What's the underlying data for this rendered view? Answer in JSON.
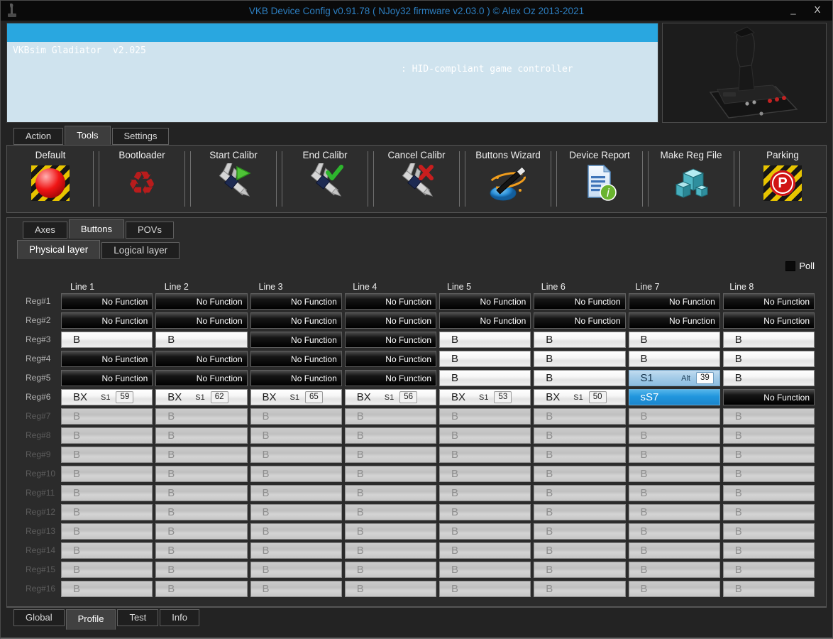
{
  "title_bar": {
    "title": "VKB Device Config v0.91.78 ( NJoy32 firmware v2.03.0 ) © Alex Oz 2013-2021",
    "minimize_label": "_",
    "close_label": "X"
  },
  "device_list": {
    "selected": {
      "name": "VKBsim Gladiator  v2.025",
      "type": ": HID-compliant game controller"
    }
  },
  "main_tabs": [
    {
      "label": "Action",
      "active": false
    },
    {
      "label": "Tools",
      "active": true
    },
    {
      "label": "Settings",
      "active": false
    }
  ],
  "toolbar": {
    "buttons": [
      {
        "label": "Default",
        "icon": "hazard-ball-icon"
      },
      {
        "label": "Bootloader",
        "icon": "recycle-icon"
      },
      {
        "label": "Start Calibr",
        "icon": "caliper-play-icon"
      },
      {
        "label": "End Calibr",
        "icon": "caliper-check-icon"
      },
      {
        "label": "Cancel Calibr",
        "icon": "caliper-cross-icon"
      },
      {
        "label": "Buttons Wizard",
        "icon": "wizard-wand-icon"
      },
      {
        "label": "Device Report",
        "icon": "document-info-icon"
      },
      {
        "label": "Make Reg File",
        "icon": "registry-cubes-icon"
      },
      {
        "label": "Parking",
        "icon": "parking-icon"
      }
    ]
  },
  "section_tabs": [
    {
      "label": "Axes",
      "active": false
    },
    {
      "label": "Buttons",
      "active": true
    },
    {
      "label": "POVs",
      "active": false
    }
  ],
  "layer_tabs": [
    {
      "label": "Physical layer",
      "active": true
    },
    {
      "label": "Logical layer",
      "active": false
    }
  ],
  "poll_label": "Poll",
  "grid": {
    "column_headers": [
      "Line 1",
      "Line 2",
      "Line 3",
      "Line 4",
      "Line 5",
      "Line 6",
      "Line 7",
      "Line 8"
    ],
    "rows": [
      {
        "label": "Reg#1",
        "enabled": true,
        "cells": [
          {
            "type": "nofunc",
            "label": "No Function"
          },
          {
            "type": "nofunc",
            "label": "No Function"
          },
          {
            "type": "nofunc",
            "label": "No Function"
          },
          {
            "type": "nofunc",
            "label": "No Function"
          },
          {
            "type": "nofunc",
            "label": "No Function"
          },
          {
            "type": "nofunc",
            "label": "No Function"
          },
          {
            "type": "nofunc",
            "label": "No Function"
          },
          {
            "type": "nofunc",
            "label": "No Function"
          }
        ]
      },
      {
        "label": "Reg#2",
        "enabled": true,
        "cells": [
          {
            "type": "nofunc",
            "label": "No Function"
          },
          {
            "type": "nofunc",
            "label": "No Function"
          },
          {
            "type": "nofunc",
            "label": "No Function"
          },
          {
            "type": "nofunc",
            "label": "No Function"
          },
          {
            "type": "nofunc",
            "label": "No Function"
          },
          {
            "type": "nofunc",
            "label": "No Function"
          },
          {
            "type": "nofunc",
            "label": "No Function"
          },
          {
            "type": "nofunc",
            "label": "No Function"
          }
        ]
      },
      {
        "label": "Reg#3",
        "enabled": true,
        "cells": [
          {
            "type": "b",
            "label": "B"
          },
          {
            "type": "b",
            "label": "B"
          },
          {
            "type": "nofunc",
            "label": "No Function"
          },
          {
            "type": "nofunc",
            "label": "No Function"
          },
          {
            "type": "b",
            "label": "B"
          },
          {
            "type": "b",
            "label": "B"
          },
          {
            "type": "b",
            "label": "B"
          },
          {
            "type": "b",
            "label": "B"
          }
        ]
      },
      {
        "label": "Reg#4",
        "enabled": true,
        "cells": [
          {
            "type": "nofunc",
            "label": "No Function"
          },
          {
            "type": "nofunc",
            "label": "No Function"
          },
          {
            "type": "nofunc",
            "label": "No Function"
          },
          {
            "type": "nofunc",
            "label": "No Function"
          },
          {
            "type": "b",
            "label": "B"
          },
          {
            "type": "b",
            "label": "B"
          },
          {
            "type": "b",
            "label": "B"
          },
          {
            "type": "b",
            "label": "B"
          }
        ]
      },
      {
        "label": "Reg#5",
        "enabled": true,
        "cells": [
          {
            "type": "nofunc",
            "label": "No Function"
          },
          {
            "type": "nofunc",
            "label": "No Function"
          },
          {
            "type": "nofunc",
            "label": "No Function"
          },
          {
            "type": "nofunc",
            "label": "No Function"
          },
          {
            "type": "b",
            "label": "B"
          },
          {
            "type": "b",
            "label": "B"
          },
          {
            "type": "alt",
            "label": "S1",
            "sub": "Alt",
            "num": "39"
          },
          {
            "type": "b",
            "label": "B"
          }
        ]
      },
      {
        "label": "Reg#6",
        "enabled": true,
        "cells": [
          {
            "type": "bx",
            "label": "BX",
            "sub": "S1",
            "num": "59"
          },
          {
            "type": "bx",
            "label": "BX",
            "sub": "S1",
            "num": "62"
          },
          {
            "type": "bx",
            "label": "BX",
            "sub": "S1",
            "num": "65"
          },
          {
            "type": "bx",
            "label": "BX",
            "sub": "S1",
            "num": "56"
          },
          {
            "type": "bx",
            "label": "BX",
            "sub": "S1",
            "num": "53"
          },
          {
            "type": "bx",
            "label": "BX",
            "sub": "S1",
            "num": "50"
          },
          {
            "type": "sel",
            "label": "sS7"
          },
          {
            "type": "nofunc",
            "label": "No Function"
          }
        ]
      },
      {
        "label": "Reg#7",
        "enabled": false,
        "cells": [
          {
            "type": "dis",
            "label": "B"
          },
          {
            "type": "dis",
            "label": "B"
          },
          {
            "type": "dis",
            "label": "B"
          },
          {
            "type": "dis",
            "label": "B"
          },
          {
            "type": "dis",
            "label": "B"
          },
          {
            "type": "dis",
            "label": "B"
          },
          {
            "type": "dis",
            "label": "B"
          },
          {
            "type": "dis",
            "label": "B"
          }
        ]
      },
      {
        "label": "Reg#8",
        "enabled": false,
        "cells": [
          {
            "type": "dis",
            "label": "B"
          },
          {
            "type": "dis",
            "label": "B"
          },
          {
            "type": "dis",
            "label": "B"
          },
          {
            "type": "dis",
            "label": "B"
          },
          {
            "type": "dis",
            "label": "B"
          },
          {
            "type": "dis",
            "label": "B"
          },
          {
            "type": "dis",
            "label": "B"
          },
          {
            "type": "dis",
            "label": "B"
          }
        ]
      },
      {
        "label": "Reg#9",
        "enabled": false,
        "cells": [
          {
            "type": "dis",
            "label": "B"
          },
          {
            "type": "dis",
            "label": "B"
          },
          {
            "type": "dis",
            "label": "B"
          },
          {
            "type": "dis",
            "label": "B"
          },
          {
            "type": "dis",
            "label": "B"
          },
          {
            "type": "dis",
            "label": "B"
          },
          {
            "type": "dis",
            "label": "B"
          },
          {
            "type": "dis",
            "label": "B"
          }
        ]
      },
      {
        "label": "Reg#10",
        "enabled": false,
        "cells": [
          {
            "type": "dis",
            "label": "B"
          },
          {
            "type": "dis",
            "label": "B"
          },
          {
            "type": "dis",
            "label": "B"
          },
          {
            "type": "dis",
            "label": "B"
          },
          {
            "type": "dis",
            "label": "B"
          },
          {
            "type": "dis",
            "label": "B"
          },
          {
            "type": "dis",
            "label": "B"
          },
          {
            "type": "dis",
            "label": "B"
          }
        ]
      },
      {
        "label": "Reg#11",
        "enabled": false,
        "cells": [
          {
            "type": "dis",
            "label": "B"
          },
          {
            "type": "dis",
            "label": "B"
          },
          {
            "type": "dis",
            "label": "B"
          },
          {
            "type": "dis",
            "label": "B"
          },
          {
            "type": "dis",
            "label": "B"
          },
          {
            "type": "dis",
            "label": "B"
          },
          {
            "type": "dis",
            "label": "B"
          },
          {
            "type": "dis",
            "label": "B"
          }
        ]
      },
      {
        "label": "Reg#12",
        "enabled": false,
        "cells": [
          {
            "type": "dis",
            "label": "B"
          },
          {
            "type": "dis",
            "label": "B"
          },
          {
            "type": "dis",
            "label": "B"
          },
          {
            "type": "dis",
            "label": "B"
          },
          {
            "type": "dis",
            "label": "B"
          },
          {
            "type": "dis",
            "label": "B"
          },
          {
            "type": "dis",
            "label": "B"
          },
          {
            "type": "dis",
            "label": "B"
          }
        ]
      },
      {
        "label": "Reg#13",
        "enabled": false,
        "cells": [
          {
            "type": "dis",
            "label": "B"
          },
          {
            "type": "dis",
            "label": "B"
          },
          {
            "type": "dis",
            "label": "B"
          },
          {
            "type": "dis",
            "label": "B"
          },
          {
            "type": "dis",
            "label": "B"
          },
          {
            "type": "dis",
            "label": "B"
          },
          {
            "type": "dis",
            "label": "B"
          },
          {
            "type": "dis",
            "label": "B"
          }
        ]
      },
      {
        "label": "Reg#14",
        "enabled": false,
        "cells": [
          {
            "type": "dis",
            "label": "B"
          },
          {
            "type": "dis",
            "label": "B"
          },
          {
            "type": "dis",
            "label": "B"
          },
          {
            "type": "dis",
            "label": "B"
          },
          {
            "type": "dis",
            "label": "B"
          },
          {
            "type": "dis",
            "label": "B"
          },
          {
            "type": "dis",
            "label": "B"
          },
          {
            "type": "dis",
            "label": "B"
          }
        ]
      },
      {
        "label": "Reg#15",
        "enabled": false,
        "cells": [
          {
            "type": "dis",
            "label": "B"
          },
          {
            "type": "dis",
            "label": "B"
          },
          {
            "type": "dis",
            "label": "B"
          },
          {
            "type": "dis",
            "label": "B"
          },
          {
            "type": "dis",
            "label": "B"
          },
          {
            "type": "dis",
            "label": "B"
          },
          {
            "type": "dis",
            "label": "B"
          },
          {
            "type": "dis",
            "label": "B"
          }
        ]
      },
      {
        "label": "Reg#16",
        "enabled": false,
        "cells": [
          {
            "type": "dis",
            "label": "B"
          },
          {
            "type": "dis",
            "label": "B"
          },
          {
            "type": "dis",
            "label": "B"
          },
          {
            "type": "dis",
            "label": "B"
          },
          {
            "type": "dis",
            "label": "B"
          },
          {
            "type": "dis",
            "label": "B"
          },
          {
            "type": "dis",
            "label": "B"
          },
          {
            "type": "dis",
            "label": "B"
          }
        ]
      }
    ]
  },
  "bottom_tabs": [
    {
      "label": "Global",
      "active": false
    },
    {
      "label": "Profile",
      "active": true
    },
    {
      "label": "Test",
      "active": false
    },
    {
      "label": "Info",
      "active": false
    }
  ],
  "colors": {
    "title_text": "#2d7fc1",
    "selection_blue": "#29a7e0",
    "active_cell_blue": "#2196dd",
    "alt_cell_blue": "#a5cce8",
    "hazard_yellow": "#e7c400",
    "alert_red": "#d01414"
  }
}
